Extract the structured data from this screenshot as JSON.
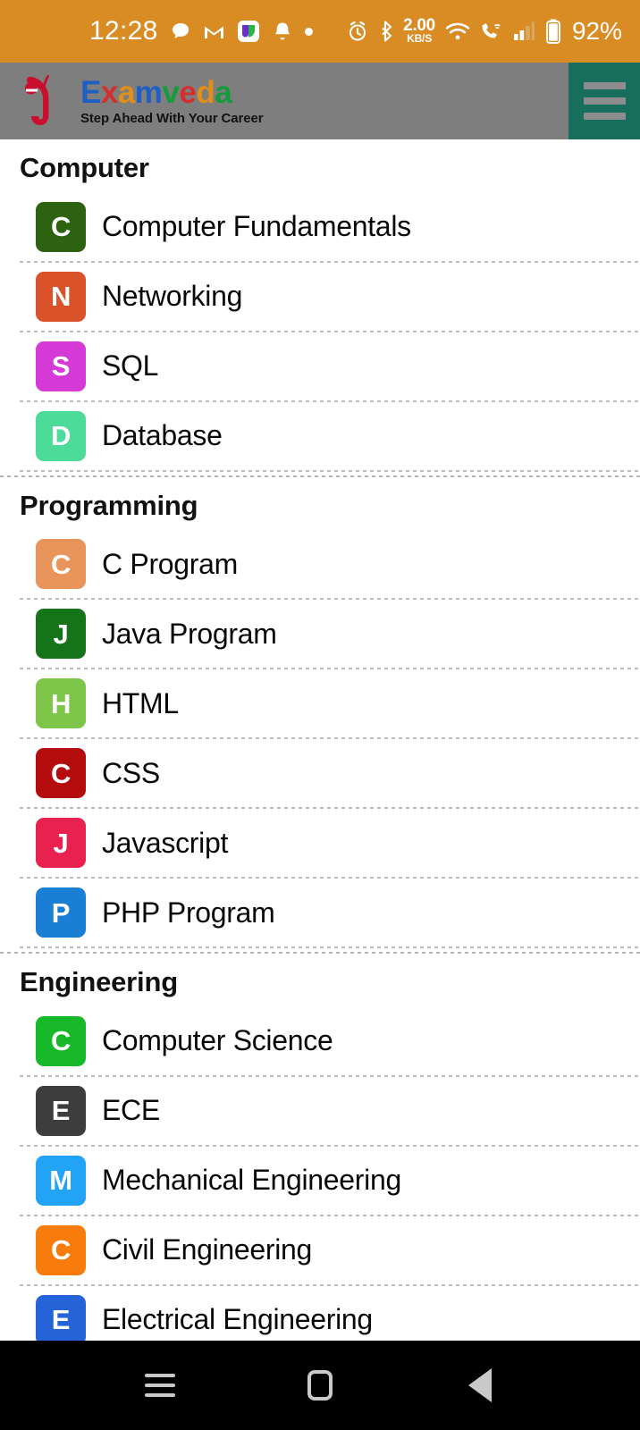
{
  "status_bar": {
    "time": "12:28",
    "network_speed_value": "2.00",
    "network_speed_unit": "KB/S",
    "battery_percent": "92%",
    "left_icons": [
      "chat-bubble-icon",
      "gmail-icon",
      "app-badge-icon",
      "bell-icon",
      "notification-dot-icon"
    ],
    "right_icons": [
      "alarm-clock-icon",
      "bluetooth-icon",
      "network-speed-indicator",
      "wifi-icon",
      "vowifi-call-icon",
      "signal-bars-icon",
      "battery-icon"
    ],
    "background_color": "#d98c24"
  },
  "app_bar": {
    "brand_letters": [
      {
        "ch": "E",
        "color": "#1f5fc4"
      },
      {
        "ch": "x",
        "color": "#d32f2f"
      },
      {
        "ch": "a",
        "color": "#e08f1a"
      },
      {
        "ch": "m",
        "color": "#1f5fc4"
      },
      {
        "ch": "v",
        "color": "#159b3b"
      },
      {
        "ch": "e",
        "color": "#d32f2f"
      },
      {
        "ch": "d",
        "color": "#e08f1a"
      },
      {
        "ch": "a",
        "color": "#159b3b"
      }
    ],
    "brand_name": "Examveda",
    "tagline": "Step Ahead With Your Career",
    "menu_label": "hamburger-menu",
    "background_color": "#7e7e7e",
    "menu_background_color": "#176e5c",
    "logo_color": "#c8102e"
  },
  "sections": [
    {
      "title": "Computer",
      "items": [
        {
          "initial": "C",
          "label": "Computer Fundamentals",
          "color": "#2d6310"
        },
        {
          "initial": "N",
          "label": "Networking",
          "color": "#d9522a"
        },
        {
          "initial": "S",
          "label": "SQL",
          "color": "#d63ad6"
        },
        {
          "initial": "D",
          "label": "Database",
          "color": "#4ddb9a"
        }
      ]
    },
    {
      "title": "Programming",
      "items": [
        {
          "initial": "C",
          "label": "C Program",
          "color": "#e8945a"
        },
        {
          "initial": "J",
          "label": "Java Program",
          "color": "#15731a"
        },
        {
          "initial": "H",
          "label": "HTML",
          "color": "#7dc64a"
        },
        {
          "initial": "C",
          "label": "CSS",
          "color": "#b50d0d"
        },
        {
          "initial": "J",
          "label": "Javascript",
          "color": "#e8214f"
        },
        {
          "initial": "P",
          "label": "PHP Program",
          "color": "#1a7fd4"
        }
      ]
    },
    {
      "title": "Engineering",
      "items": [
        {
          "initial": "C",
          "label": "Computer Science",
          "color": "#17b82a"
        },
        {
          "initial": "E",
          "label": "ECE",
          "color": "#3d3d3d"
        },
        {
          "initial": "M",
          "label": "Mechanical Engineering",
          "color": "#23a3f5"
        },
        {
          "initial": "C",
          "label": "Civil Engineering",
          "color": "#f87c0c"
        },
        {
          "initial": "E",
          "label": "Electrical Engineering",
          "color": "#2463d8"
        }
      ]
    }
  ],
  "nav_bar": {
    "recent_label": "recent-apps",
    "home_label": "home",
    "back_label": "back",
    "background_color": "#000000"
  }
}
